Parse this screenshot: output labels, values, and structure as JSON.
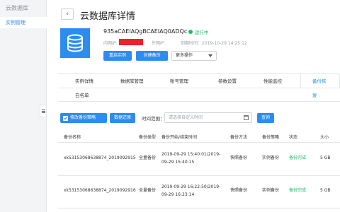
{
  "sidebar": {
    "title": "云数据库",
    "items": [
      {
        "label": "实例管理"
      }
    ]
  },
  "header": {
    "back_icon": "‹",
    "title": "云数据库详情"
  },
  "db": {
    "name": "935aCAEIAQgBCAEIAQ0ADQc",
    "status": "运行中",
    "inner_ip_label": "内网IP：",
    "outer_ip_label": "外网IP：",
    "expire_label": "到期时间：",
    "expire_time": "2019-10-29 14:25:12"
  },
  "actions": {
    "restart": "重启实例",
    "backup": "创建备份",
    "more": "更多操作"
  },
  "tabs": [
    "实例详情",
    "数据库管理",
    "账号管理",
    "参数设置",
    "性能监控",
    "备份恢复",
    "白名单"
  ],
  "active_tab": "备份恢复",
  "toolbar": {
    "modify": "修改备份策略",
    "restore": "数据还原",
    "range_label": "时间范围：",
    "date_placeholder": "请选择自定义时间",
    "query": "查询"
  },
  "table": {
    "headers": [
      "备份名称",
      "备份类型",
      "备份开始/结束时间",
      "备份方法",
      "备份策略",
      "状态",
      "大小"
    ],
    "rows": [
      {
        "name": "xk53153068638874_2019092915",
        "type": "全量备份",
        "time1": "2019-09-29 15:40:01/2019-",
        "time2": "09-29 15:40:15",
        "method": "快照备份",
        "policy": "实例备份",
        "status": "备份完成",
        "size": "5 GB"
      },
      {
        "name": "xk53153068638874_2019092916",
        "type": "全量备份",
        "time1": "2019-09-29 16:22:50/2019-",
        "time2": "09-29 16:23:14",
        "method": "快照备份",
        "policy": "实例备份",
        "status": "备份完成",
        "size": "5 GB"
      }
    ]
  },
  "colors": {
    "accent": "#2d8cf0",
    "success": "#19be6b",
    "redaction": "#e8242a"
  }
}
